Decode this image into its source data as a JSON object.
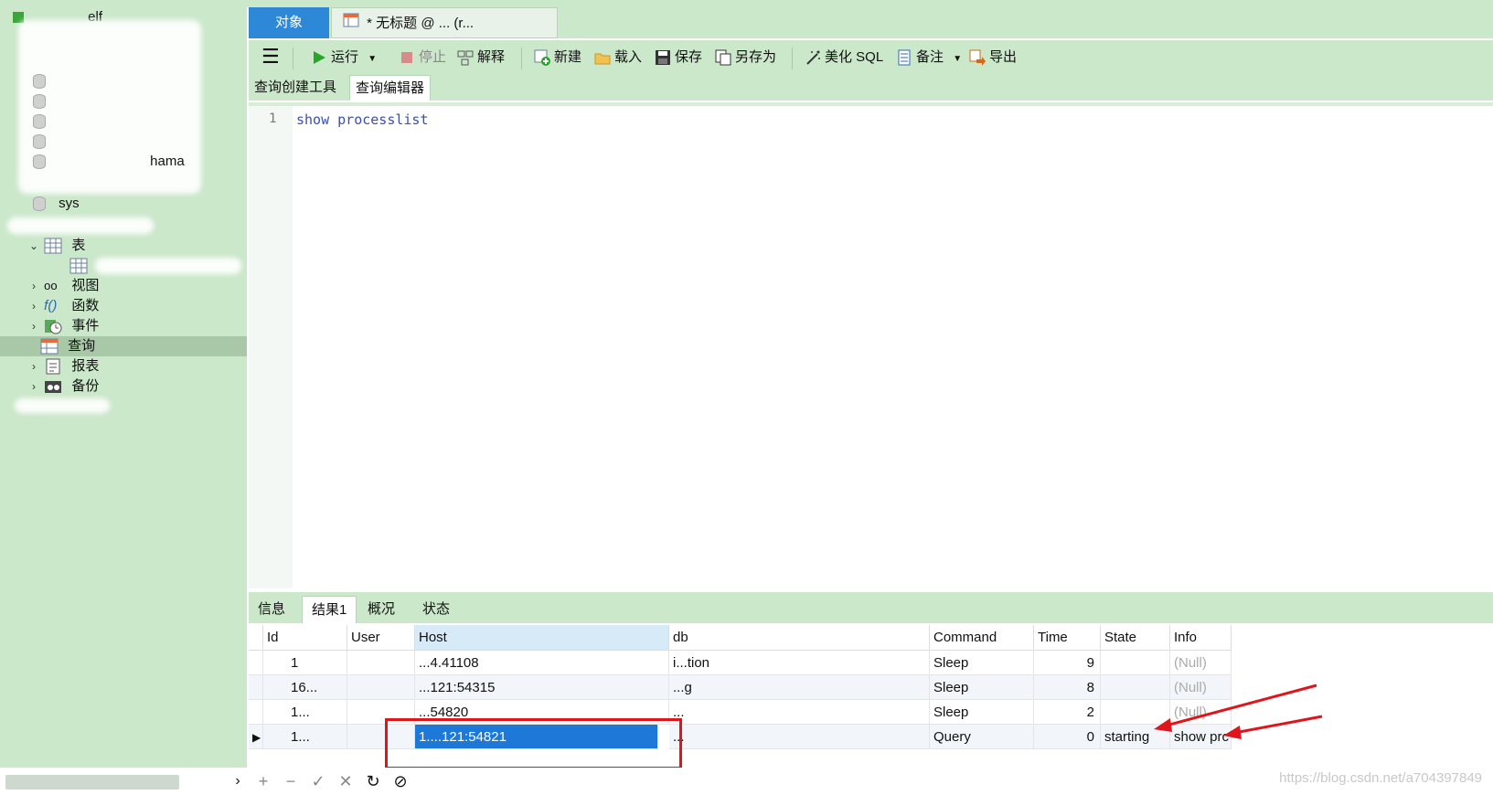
{
  "sidebar": {
    "connection_suffix": "elf",
    "db_sys": "sys",
    "db_partial": "hama",
    "nodes": {
      "tables": "表",
      "views": "视图",
      "functions": "函数",
      "events": "事件",
      "queries": "查询",
      "reports": "报表",
      "backups": "备份"
    }
  },
  "tabs": {
    "objects": "对象",
    "query": "* 无标题 @ ... (r..."
  },
  "toolbar": {
    "run": "运行",
    "stop": "停止",
    "explain": "解释",
    "new": "新建",
    "load": "载入",
    "save": "保存",
    "save_as": "另存为",
    "beautify": "美化 SQL",
    "comment": "备注",
    "export": "导出"
  },
  "subtabs": {
    "builder": "查询创建工具",
    "editor": "查询编辑器"
  },
  "editor": {
    "line_number": "1",
    "code": "show processlist"
  },
  "result_tabs": {
    "info": "信息",
    "result1": "结果1",
    "overview": "概况",
    "status": "状态"
  },
  "grid": {
    "columns": [
      "Id",
      "User",
      "Host",
      "db",
      "Command",
      "Time",
      "State",
      "Info"
    ],
    "rows": [
      {
        "id": "1",
        "user": "",
        "host": "...4.41108",
        "db": "i...tion",
        "command": "Sleep",
        "time": "9",
        "state": "",
        "info": "(Null)"
      },
      {
        "id": "16...",
        "user": "",
        "host": "...121:54315",
        "db": "...g",
        "command": "Sleep",
        "time": "8",
        "state": "",
        "info": "(Null)"
      },
      {
        "id": "1...",
        "user": "",
        "host": "...54820",
        "db": "...",
        "command": "Sleep",
        "time": "2",
        "state": "",
        "info": "(Null)"
      },
      {
        "id": "1...",
        "user": "",
        "host": "1....121:54821",
        "db": "...",
        "command": "Query",
        "time": "0",
        "state": "starting",
        "info": "show prc"
      }
    ]
  },
  "watermark": "https://blog.csdn.net/a704397849",
  "colors": {
    "sidebar_bg": "#cbe8cb",
    "accent": "#2d89d8",
    "selection": "#1d78d8",
    "annotation": "#e0151b"
  }
}
